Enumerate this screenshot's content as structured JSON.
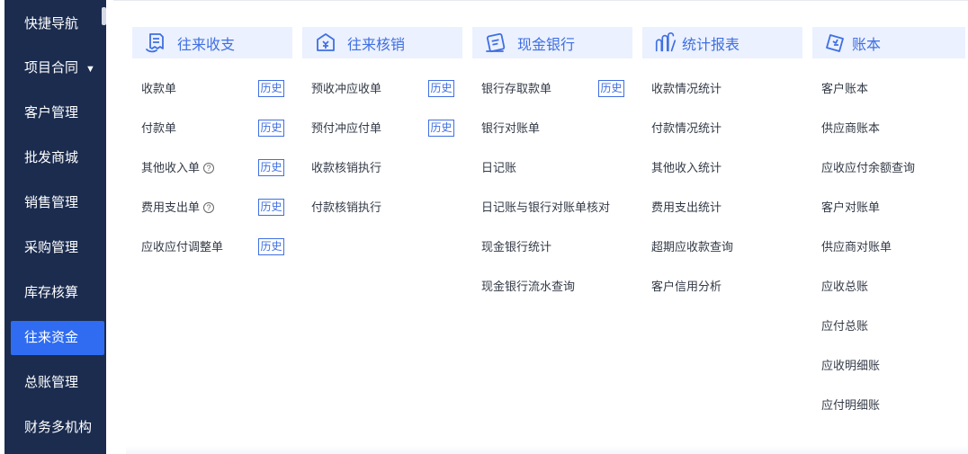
{
  "sidebar": {
    "items": [
      {
        "label": "快捷导航"
      },
      {
        "label": "项目合同",
        "caret": "▼"
      },
      {
        "label": "客户管理"
      },
      {
        "label": "批发商城"
      },
      {
        "label": "销售管理"
      },
      {
        "label": "采购管理"
      },
      {
        "label": "库存核算"
      },
      {
        "label": "往来资金",
        "active": true
      },
      {
        "label": "总账管理"
      },
      {
        "label": "财务多机构"
      }
    ]
  },
  "history_label": "历史",
  "help_glyph": "?",
  "colors": {
    "sidebar_bg": "#1b2c4f",
    "accent": "#3f6fe2",
    "active": "#2f6cf1",
    "header_bg": "#ebf1fe"
  },
  "columns": [
    {
      "title": "往来收支",
      "icon": "receipt-icon",
      "links": [
        "收款单",
        "付款单",
        "其他收入单",
        "费用支出单",
        "应收应付调整单"
      ]
    },
    {
      "title": "往来核销",
      "icon": "voucher-icon",
      "links": [
        "预收冲应收单",
        "预付冲应付单",
        "收款核销执行",
        "付款核销执行"
      ]
    },
    {
      "title": "现金银行",
      "icon": "bank-card-icon",
      "links": [
        "银行存取款单",
        "银行对账单",
        "日记账",
        "日记账与银行对账单核对",
        "现金银行统计",
        "现金银行流水查询"
      ]
    },
    {
      "title": "统计报表",
      "icon": "report-icon",
      "links": [
        "收款情况统计",
        "付款情况统计",
        "其他收入统计",
        "费用支出统计",
        "超期应收款查询",
        "客户信用分析"
      ]
    },
    {
      "title": "账本",
      "icon": "ledger-icon",
      "links": [
        "客户账本",
        "供应商账本",
        "应收应付余额查询",
        "客户对账单",
        "供应商对账单",
        "应收总账",
        "应付总账",
        "应收明细账",
        "应付明细账"
      ]
    }
  ]
}
